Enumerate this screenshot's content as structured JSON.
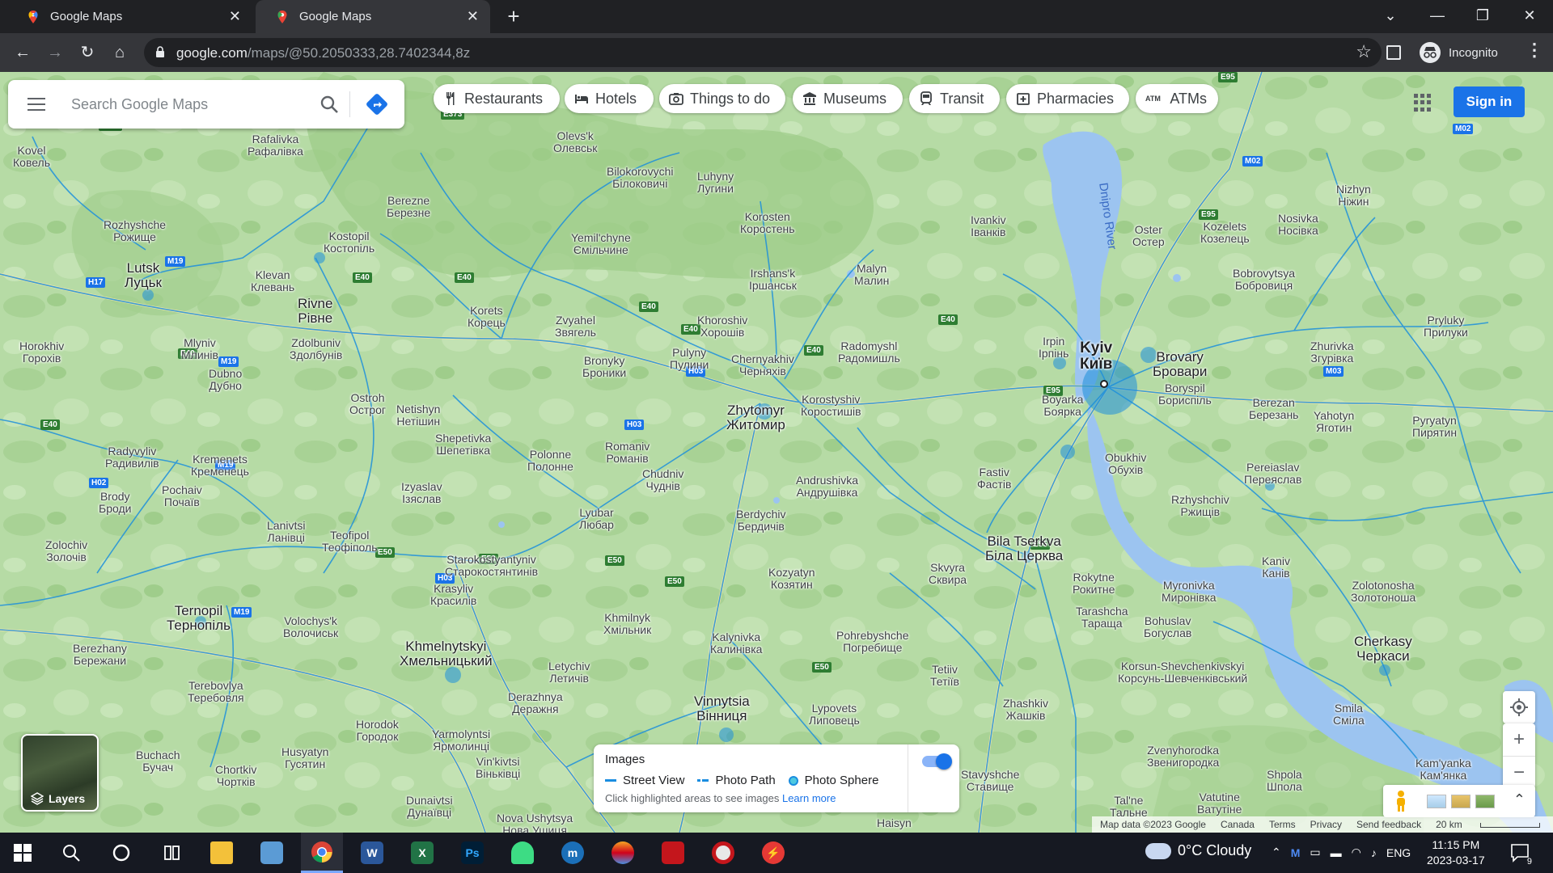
{
  "browser": {
    "tabs": [
      {
        "title": "Google Maps"
      },
      {
        "title": "Google Maps"
      }
    ],
    "url_host": "google.com",
    "url_path": "/maps/@50.2050333,28.7402344,8z",
    "profile_label": "Incognito"
  },
  "maps": {
    "search_placeholder": "Search Google Maps",
    "chips": [
      {
        "label": "Restaurants",
        "icon": "fork-knife-icon"
      },
      {
        "label": "Hotels",
        "icon": "bed-icon"
      },
      {
        "label": "Things to do",
        "icon": "camera-icon"
      },
      {
        "label": "Museums",
        "icon": "museum-icon"
      },
      {
        "label": "Transit",
        "icon": "train-icon"
      },
      {
        "label": "Pharmacies",
        "icon": "pharmacy-icon"
      },
      {
        "label": "ATMs",
        "icon": "atm-icon"
      }
    ],
    "sign_in": "Sign in",
    "layers_label": "Layers",
    "images_panel": {
      "title": "Images",
      "legend": [
        "Street View",
        "Photo Path",
        "Photo Sphere"
      ],
      "hint": "Click highlighted areas to see images",
      "learn_more": "Learn more",
      "toggle_on": true
    },
    "footer": {
      "map_data": "Map data ©2023 Google",
      "country": "Canada",
      "terms": "Terms",
      "privacy": "Privacy",
      "feedback": "Send feedback",
      "scale": "20 km"
    },
    "places": {
      "kyiv": [
        "Kyiv",
        "Київ"
      ],
      "zhytomyr": [
        "Zhytomyr",
        "Житомир"
      ],
      "bila": [
        "Bila Tserkva",
        "Біла Церква"
      ],
      "rivne": [
        "Rivne",
        "Рівне"
      ],
      "lutsk": [
        "Lutsk",
        "Луцьк"
      ],
      "ternopil": [
        "Ternopil",
        "Тернопіль"
      ],
      "khmel": [
        "Khmelnytskyi",
        "Хмельницький"
      ],
      "vinnytsia": [
        "Vinnytsia",
        "Вінниця"
      ],
      "cherkasy": [
        "Cherkasy",
        "Черкаси"
      ],
      "brovary": [
        "Brovary",
        "Бровари"
      ],
      "korosten": [
        "Korosten",
        "Коростень"
      ],
      "berdychiv": [
        "Berdychiv",
        "Бердичів"
      ],
      "fastiv": [
        "Fastiv",
        "Фастів"
      ],
      "irpin": [
        "Irpin",
        "Ірпінь"
      ],
      "boyarka": [
        "Boyarka",
        "Боярка"
      ],
      "obukhiv": [
        "Obukhiv",
        "Обухів"
      ],
      "boryspil": [
        "Boryspil",
        "Бориспіль"
      ],
      "novohrad": [
        "Zvyahel",
        "Звягель"
      ],
      "korostyshiv": [
        "Korostyshiv",
        "Коростишів"
      ],
      "radomyshl": [
        "Radomyshl",
        "Радомишль"
      ],
      "malyn": [
        "Malyn",
        "Малин"
      ],
      "chernyakhiv": [
        "Chernyakhiv",
        "Черняхів"
      ],
      "andrushivka": [
        "Andrushivka",
        "Андрушівка"
      ],
      "skvyra": [
        "Skvyra",
        "Сквира"
      ],
      "kozyatyn": [
        "Kozyatyn",
        "Козятин"
      ],
      "starokostiantyniv": [
        "Starokostyantyniv",
        "Старокостянтинів"
      ],
      "shepetivka": [
        "Shepetivka",
        "Шепетівка"
      ],
      "netishyn": [
        "Netishyn",
        "Нетішин"
      ],
      "ostroh": [
        "Ostroh",
        "Острог"
      ],
      "dubno": [
        "Dubno",
        "Дубно"
      ],
      "polonne": [
        "Polonne",
        "Полонне"
      ],
      "lyubar": [
        "Lyubar",
        "Любар"
      ],
      "kalynivka": [
        "Kalynivka",
        "Калинівка"
      ],
      "khmilnyk": [
        "Khmilnyk",
        "Хмільник"
      ],
      "letychiv": [
        "Letychiv",
        "Летичів"
      ],
      "derazhnya": [
        "Derazhnya",
        "Деражня"
      ],
      "kremenets": [
        "Kremenets",
        "Кременець"
      ],
      "zolochiv": [
        "Zolochiv",
        "Золочів"
      ],
      "berezhany": [
        "Berezhany",
        "Бережани"
      ],
      "terebovlya": [
        "Terebovlya",
        "Теребовля"
      ],
      "pereiaslav": [
        "Pereiaslav",
        "Переяслав"
      ],
      "kaniv": [
        "Kaniv",
        "Канів"
      ],
      "smila": [
        "Smila",
        "Сміла"
      ],
      "zhashkiv": [
        "Zhashkiv",
        "Жашків"
      ],
      "tetiiv": [
        "Tetiiv",
        "Тетіїв"
      ],
      "lypovets": [
        "Lypovets",
        "Липовець"
      ],
      "korsun": [
        "Korsun-Shevchenkivskyi",
        "Корсунь-Шевченківський"
      ],
      "bohuslav": [
        "Bohuslav",
        "Богуслав"
      ],
      "myronivka": [
        "Myronivka",
        "Миронівка"
      ],
      "rzhyshchiv": [
        "Rzhyshchiv",
        "Ржищів"
      ],
      "vasylkiv": [
        "Fastiv",
        "Фастів"
      ],
      "ivankiv": [
        "Ivankiv",
        "Іванків"
      ],
      "oster": [
        "Oster",
        "Остер"
      ],
      "kozelets": [
        "Kozelets",
        "Козелець"
      ],
      "nizhyn": [
        "Nizhyn",
        "Ніжин"
      ],
      "nosivka": [
        "Nosivka",
        "Носівка"
      ],
      "bobrovytsia": [
        "Bobrovytsya",
        "Бобровиця"
      ],
      "yahotyn": [
        "Yahotyn",
        "Яготин"
      ],
      "berezan": [
        "Berezan",
        "Березань"
      ],
      "zhurivka": [
        "Zhurivka",
        "Згурівка"
      ],
      "pryluky": [
        "Pryluky",
        "Прилуки"
      ],
      "pyriatyn": [
        "Pyryatyn",
        "Пирятин"
      ],
      "zolotonosha": [
        "Zolotonosha",
        "Золотоноша"
      ],
      "zvenyhorodka": [
        "Zvenyhorodka",
        "Звенигородка"
      ],
      "shpola": [
        "Shpola",
        "Шпола"
      ],
      "vatutine": [
        "Vatutine",
        "Ватутіне"
      ],
      "pohrebyshche": [
        "Pohrebyshche",
        "Погребище"
      ],
      "rokytne": [
        "Rokytne",
        "Рокитне"
      ],
      "tarashcha": [
        "Tarashcha",
        "Тараща"
      ],
      "kamyanka": [
        "Kam'yanka",
        "Кам'янка"
      ],
      "olevsk": [
        "Olevs'k",
        "Олевськ"
      ],
      "luhyny": [
        "Luhyny",
        "Лугини"
      ],
      "bilokorovychi": [
        "Bilokorovychi",
        "Білоковичі"
      ],
      "yemilchyne": [
        "Yemil'chyne",
        "Ємільчине"
      ],
      "irshansk": [
        "Irshans'k",
        "Іршанськ"
      ],
      "khoroshiv": [
        "Khoroshiv",
        "Хорошів"
      ],
      "pulyny": [
        "Pulyny",
        "Пулини"
      ],
      "bronyky": [
        "Bronyky",
        "Броники"
      ],
      "korets": [
        "Korets",
        "Корець"
      ],
      "berezne": [
        "Berezne",
        "Березне"
      ],
      "kostopil": [
        "Kostopil",
        "Костопіль"
      ],
      "klevan": [
        "Klevan",
        "Клевань"
      ],
      "rozhyshche": [
        "Rozhyshche",
        "Рожище"
      ],
      "kovel": [
        "Kovel",
        "Ковель"
      ],
      "rafalivka": [
        "Rafalivka",
        "Рафалівка"
      ],
      "mlyniv": [
        "Mlyniv",
        "Млинів"
      ],
      "zdolbuniv": [
        "Zdolbuniv",
        "Здолбунів"
      ],
      "horokhiv": [
        "Horokhiv",
        "Горохів"
      ],
      "radyvyliv": [
        "Radyvyliv",
        "Радивилів"
      ],
      "brody": [
        "Brody",
        "Броди"
      ],
      "pochaiv": [
        "Pochaiv",
        "Почаїв"
      ],
      "lanivtsi": [
        "Lanivtsi",
        "Ланівці"
      ],
      "teofipol": [
        "Teofipol",
        "Теофіполь"
      ],
      "izyaslav": [
        "Izyaslav",
        "Ізяслав"
      ],
      "krasyliv": [
        "Krasyliv",
        "Красилів"
      ],
      "volochysk": [
        "Volochys'k",
        "Волочиськ"
      ],
      "romaniv": [
        "Romaniv",
        "Романів"
      ],
      "chudniv": [
        "Chudniv",
        "Чуднів"
      ],
      "horodok": [
        "Horodok",
        "Городок"
      ],
      "yarmolyntsi": [
        "Yarmolyntsi",
        "Ярмолинці"
      ],
      "vinkivtsi": [
        "Vin'kivtsi",
        "Віньківці"
      ],
      "husiatyn": [
        "Husyatyn",
        "Гусятин"
      ],
      "chortkiv": [
        "Chortkiv",
        "Чортків"
      ],
      "buchach": [
        "Buchach",
        "Бучач"
      ],
      "dunaivtsi": [
        "Dunaivtsi",
        "Дунаївці"
      ],
      "nova_ushytsia": [
        "Nova Ushytsya",
        "Нова Ушиця"
      ],
      "stryshche": [
        "Stavyshche",
        "Ставище"
      ],
      "talne": [
        "Tal'ne",
        "Тальне"
      ],
      "haisyn": [
        "Haisyn",
        ""
      ]
    },
    "river_label": "Dnipro River"
  },
  "taskbar": {
    "weather": "0°C  Cloudy",
    "tray_lang": "ENG",
    "time": "11:15 PM",
    "date": "2023-03-17",
    "notifications": "9",
    "apps": [
      "file-explorer",
      "control-panel",
      "chrome",
      "word",
      "excel",
      "photoshop",
      "android-app",
      "mo-app",
      "game-app",
      "red-app",
      "recorder-app",
      "power-app"
    ]
  }
}
